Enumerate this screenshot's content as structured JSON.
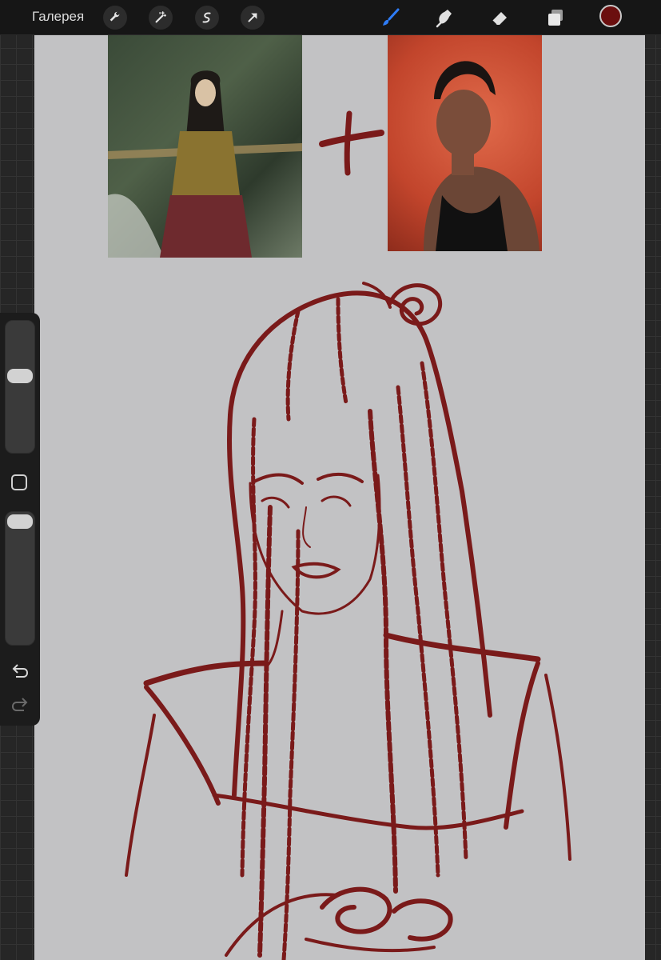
{
  "toolbar": {
    "gallery_label": "Галерея",
    "left_tools": [
      "wrench-icon",
      "magic-wand-icon",
      "selection-s-icon",
      "transform-arrow-icon"
    ],
    "right_tools": [
      "brush-icon",
      "smudge-icon",
      "eraser-icon",
      "layers-icon"
    ],
    "active_tool": "brush-icon",
    "accent_color": "#2e7cf6",
    "current_color": "#6b0f0f"
  },
  "canvas": {
    "background": "#c2c2c4",
    "stroke_color": "#7a1a1a",
    "references": [
      "fantasy-woman-painting",
      "woman-portrait-photo"
    ]
  },
  "sidebar": {
    "brush_size": 0.6,
    "brush_opacity": 1.0,
    "icons": [
      "modify-button",
      "undo-icon",
      "redo-icon"
    ]
  }
}
